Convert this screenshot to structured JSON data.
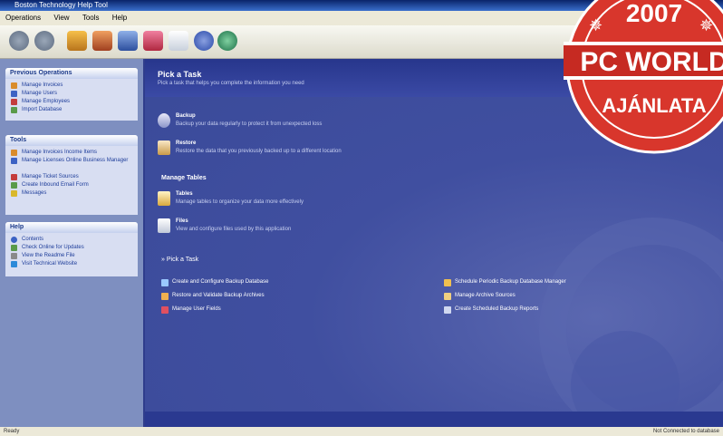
{
  "window": {
    "title": "Boston Technology Help Tool"
  },
  "menu": [
    "Operations",
    "View",
    "Tools",
    "Help"
  ],
  "sidebar": {
    "panels": [
      {
        "title": "Previous Operations",
        "items": [
          "Manage Invoices",
          "Manage Users",
          "Manage Employees",
          "Import Database"
        ]
      },
      {
        "title": "Tools",
        "items": [
          "Manage Invoices Income Items",
          "Manage Licenses Online Business Manager",
          "Manage Ticket Sources",
          "Create Inbound Email Form",
          "Messages"
        ]
      },
      {
        "title": "Help",
        "items": [
          "Contents",
          "Check Online for Updates",
          "View the Readme File",
          "Visit Technical Website"
        ]
      }
    ]
  },
  "main": {
    "title": "Pick a Task",
    "subtitle": "Pick a task that helps you complete the information you need",
    "tasks": [
      {
        "title": "Backup",
        "desc": "Backup your data regularly to protect it from unexpected loss"
      },
      {
        "title": "Restore",
        "desc": "Restore the data that you previously backed up to a different location"
      }
    ],
    "section_label": "Manage Tables",
    "manage": [
      {
        "title": "Tables",
        "desc": "Manage tables to organize your data more effectively"
      },
      {
        "title": "Files",
        "desc": "View and configure files used by this application"
      }
    ],
    "pick_label": "Pick a Task",
    "links_left": [
      "Create and Configure Backup Database",
      "Restore and Validate Backup Archives",
      "Manage User Fields"
    ],
    "links_right": [
      "Schedule Periodic Backup Database Manager",
      "Manage Archive Sources",
      "Create Scheduled Backup Reports"
    ]
  },
  "status": {
    "left": "Ready",
    "right": "Not Connected to database"
  },
  "stamp": {
    "year": "2007",
    "brand": "PC WORLD",
    "caption": "AJÁNLATA"
  },
  "colors": {
    "main_bg": "#3a4a99",
    "sidebar_bg": "#7e8fc0",
    "stamp_red": "#d8362c"
  }
}
